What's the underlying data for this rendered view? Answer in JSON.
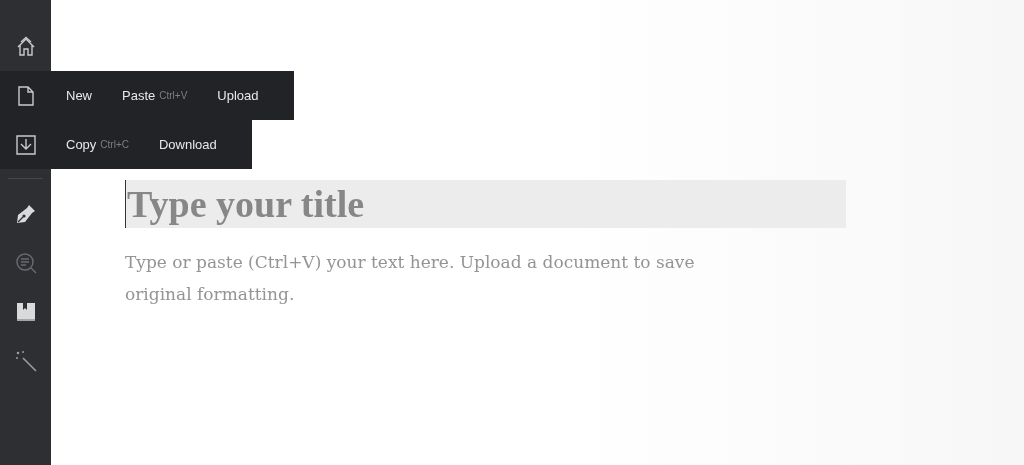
{
  "sidebar": {
    "items": [
      {
        "expanded": false
      },
      {
        "expanded": true,
        "menu": [
          {
            "label": "New"
          },
          {
            "label": "Paste",
            "shortcut": "Ctrl+V"
          },
          {
            "label": "Upload"
          }
        ]
      },
      {
        "expanded": true,
        "menu": [
          {
            "label": "Copy",
            "shortcut": "Ctrl+C"
          },
          {
            "label": "Download"
          }
        ]
      },
      {
        "expanded": false
      },
      {
        "expanded": false
      },
      {
        "expanded": false
      },
      {
        "expanded": false
      }
    ]
  },
  "editor": {
    "title": {
      "placeholder": "Type your title"
    },
    "body": {
      "placeholder": "Type or paste (Ctrl+V) your text here. Upload a document to save original formatting."
    }
  }
}
